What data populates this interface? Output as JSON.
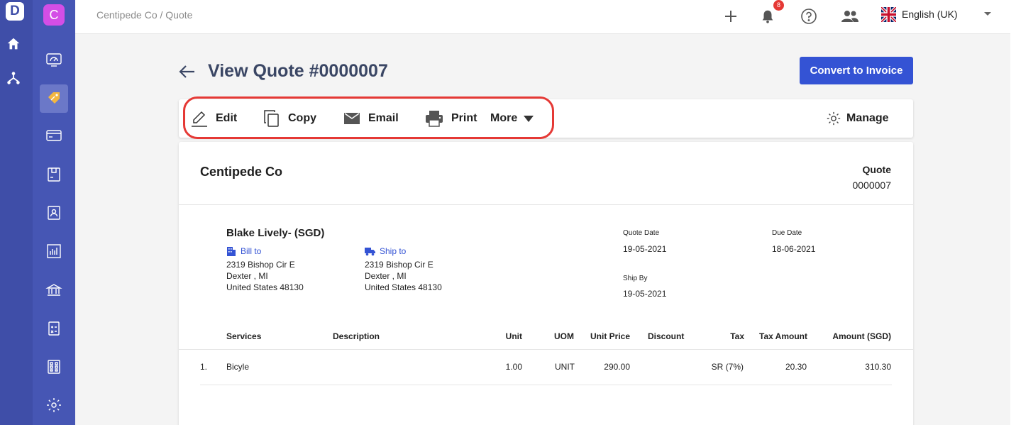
{
  "app": {
    "logo_letter": "D",
    "org_initial": "C"
  },
  "breadcrumb": "Centipede Co / Quote",
  "topbar": {
    "notification_count": "8",
    "language": "English (UK)"
  },
  "page": {
    "title": "View Quote #0000007",
    "convert_label": "Convert to Invoice"
  },
  "toolbar": {
    "edit": "Edit",
    "copy": "Copy",
    "email": "Email",
    "print": "Print",
    "more": "More",
    "manage": "Manage"
  },
  "document": {
    "company": "Centipede Co",
    "type": "Quote",
    "number": "0000007",
    "customer": "Blake Lively- (SGD)",
    "bill_to": {
      "label": "Bill to",
      "line1": "2319 Bishop Cir E",
      "line2": "Dexter , MI",
      "line3": "United States 48130"
    },
    "ship_to": {
      "label": "Ship to",
      "line1": "2319 Bishop Cir E",
      "line2": "Dexter , MI",
      "line3": "United States 48130"
    },
    "quote_date_label": "Quote Date",
    "quote_date": "19-05-2021",
    "due_date_label": "Due Date",
    "due_date": "18-06-2021",
    "ship_by_label": "Ship By",
    "ship_by": "19-05-2021"
  },
  "table": {
    "headers": [
      "Services",
      "Description",
      "Unit",
      "UOM",
      "Unit Price",
      "Discount",
      "Tax",
      "Tax Amount",
      "Amount (SGD)"
    ],
    "rows": [
      {
        "index": "1.",
        "service": "Bicyle",
        "description": "",
        "unit": "1.00",
        "uom": "UNIT",
        "unit_price": "290.00",
        "discount": "",
        "tax": "SR (7%)",
        "tax_amount": "20.30",
        "amount": "310.30"
      }
    ]
  },
  "colors": {
    "sidebar": "#3f4ea8",
    "accent": "#3453d4",
    "highlight": "#e53935",
    "title": "#3a4664"
  }
}
